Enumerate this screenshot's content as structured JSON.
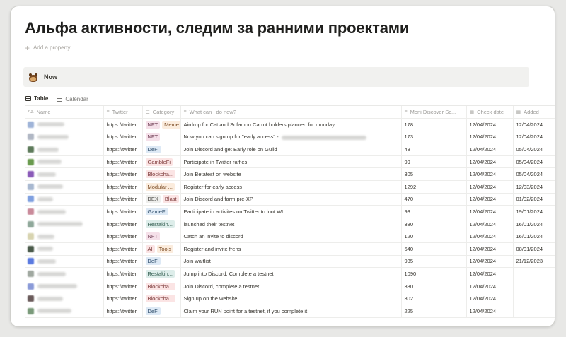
{
  "page": {
    "title": "Альфа активности, следим за ранними проектами",
    "add_property": "Add a property"
  },
  "callout": {
    "text": "Now",
    "icon": "beaver-emoji-icon"
  },
  "tabs": [
    {
      "label": "Table",
      "icon": "table-icon",
      "active": true
    },
    {
      "label": "Calendar",
      "icon": "calendar-icon",
      "active": false
    }
  ],
  "columns": [
    {
      "label": "Name",
      "icon": "Aa"
    },
    {
      "label": "Twitter",
      "icon": "≡"
    },
    {
      "label": "Category",
      "icon": "☰"
    },
    {
      "label": "What can I do now?",
      "icon": "≡"
    },
    {
      "label": "Moni Discover Sc...",
      "icon": "≡"
    },
    {
      "label": "Check date",
      "icon": "▦"
    },
    {
      "label": "Added",
      "icon": "▦"
    }
  ],
  "tag_colors": {
    "NFT": {
      "bg": "#f5e0e9",
      "fg": "#6c3a51"
    },
    "Meme": {
      "bg": "#fbecdd",
      "fg": "#7a4a22"
    },
    "DeFi": {
      "bg": "#dde9f5",
      "fg": "#2f4e6b"
    },
    "GambleFi": {
      "bg": "#fbe4e4",
      "fg": "#7d3a3a"
    },
    "Blockcha...": {
      "bg": "#fbe4e4",
      "fg": "#7d3a3a"
    },
    "Modular ...": {
      "bg": "#fbecdd",
      "fg": "#7a4a22"
    },
    "DEX": {
      "bg": "#eeeeec",
      "fg": "#4a4945"
    },
    "Blast": {
      "bg": "#fbe4e4",
      "fg": "#7d3a3a"
    },
    "GameFi": {
      "bg": "#dde9f5",
      "fg": "#2f4e6b"
    },
    "Restakin...": {
      "bg": "#ddedea",
      "fg": "#2f5a4c"
    },
    "AI": {
      "bg": "#fbe4e4",
      "fg": "#7d3a3a"
    },
    "Tools": {
      "bg": "#fbecdd",
      "fg": "#7a4a22"
    }
  },
  "rows": [
    {
      "avatar": "#9fb4d8",
      "twitter": "https://twitter.",
      "tags": [
        "NFT",
        "Meme"
      ],
      "action": "Airdrop for Cat and Sofamon Carrot holders planned for monday",
      "score": "178",
      "check": "12/04/2024",
      "added": "12/04/2024"
    },
    {
      "avatar": "#b0b7c4",
      "twitter": "https://twitter.",
      "tags": [
        "NFT"
      ],
      "action": "Now you can sign up for \"early access\" -",
      "score": "173",
      "check": "12/04/2024",
      "added": "12/04/2024"
    },
    {
      "avatar": "#5d7a5a",
      "twitter": "https://twitter.",
      "tags": [
        "DeFi"
      ],
      "action": "Join Discord and get Early role on Guild",
      "score": "48",
      "check": "12/04/2024",
      "added": "05/04/2024"
    },
    {
      "avatar": "#6a9b4e",
      "twitter": "https://twitter.",
      "tags": [
        "GambleFi"
      ],
      "action": "Participate in Twitter raffles",
      "score": "99",
      "check": "12/04/2024",
      "added": "05/04/2024"
    },
    {
      "avatar": "#8a5ab8",
      "twitter": "https://twitter.",
      "tags": [
        "Blockcha..."
      ],
      "action": "Join Betatest on website",
      "score": "305",
      "check": "12/04/2024",
      "added": "05/04/2024"
    },
    {
      "avatar": "#a8b8d0",
      "twitter": "https://twitter.",
      "tags": [
        "Modular ..."
      ],
      "action": "Register for early access",
      "score": "1292",
      "check": "12/04/2024",
      "added": "12/03/2024"
    },
    {
      "avatar": "#7fa0e0",
      "twitter": "https://twitter.",
      "tags": [
        "DEX",
        "Blast"
      ],
      "action": "Join Discord and farm pre-XP",
      "score": "470",
      "check": "12/04/2024",
      "added": "01/02/2024"
    },
    {
      "avatar": "#c98a9a",
      "twitter": "https://twitter.",
      "tags": [
        "GameFi"
      ],
      "action": "Participate in activites on Twitter to loot WL",
      "score": "93",
      "check": "12/04/2024",
      "added": "19/01/2024"
    },
    {
      "avatar": "#8fa89a",
      "twitter": "https://twitter.",
      "tags": [
        "Restakin..."
      ],
      "action": "launched their testnet",
      "score": "380",
      "check": "12/04/2024",
      "added": "16/01/2024"
    },
    {
      "avatar": "#d8d4b0",
      "twitter": "https://twitter.",
      "tags": [
        "NFT"
      ],
      "action": "Catch an invite to discord",
      "score": "120",
      "check": "12/04/2024",
      "added": "16/01/2024"
    },
    {
      "avatar": "#4a5a4a",
      "twitter": "https://twitter.",
      "tags": [
        "AI",
        "Tools"
      ],
      "action": "Register and invite frens",
      "score": "640",
      "check": "12/04/2024",
      "added": "08/01/2024"
    },
    {
      "avatar": "#5a7ae0",
      "twitter": "https://twitter.",
      "tags": [
        "DeFi"
      ],
      "action": "Join waitlist",
      "score": "935",
      "check": "12/04/2024",
      "added": "21/12/2023"
    },
    {
      "avatar": "#a0a8a0",
      "twitter": "https://twitter.",
      "tags": [
        "Restakin..."
      ],
      "action": "Jump into Discord, Complete a testnet",
      "score": "1090",
      "check": "12/04/2024",
      "added": ""
    },
    {
      "avatar": "#8a9ad8",
      "twitter": "https://twitter.",
      "tags": [
        "Blockcha..."
      ],
      "action": "Join Discord, complete a testnet",
      "score": "330",
      "check": "12/04/2024",
      "added": ""
    },
    {
      "avatar": "#6a5a5a",
      "twitter": "https://twitter.",
      "tags": [
        "Blockcha..."
      ],
      "action": "Sign up on the website",
      "score": "302",
      "check": "12/04/2024",
      "added": ""
    },
    {
      "avatar": "#7a9a7a",
      "twitter": "https://twitter.",
      "tags": [
        "DeFi"
      ],
      "action": "Claim your RUN point for a testnet, if you complete it",
      "score": "225",
      "check": "12/04/2024",
      "added": ""
    }
  ]
}
